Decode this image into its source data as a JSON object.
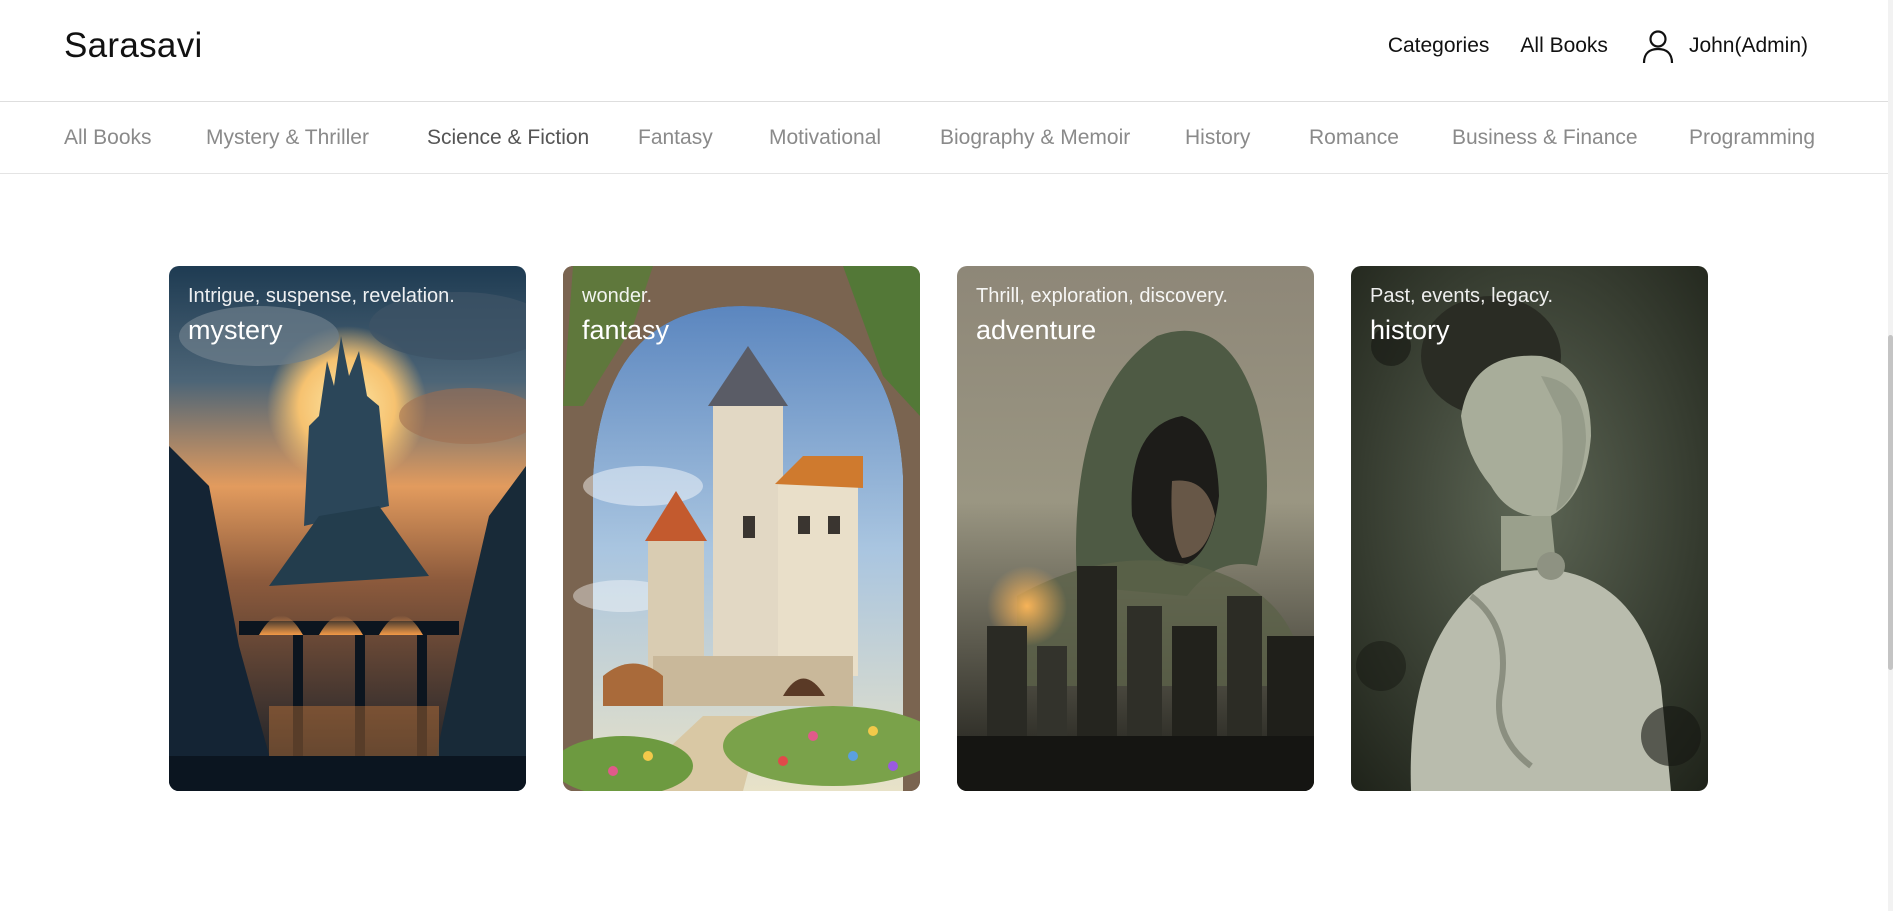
{
  "brand": "Sarasavi",
  "top_nav": {
    "categories_label": "Categories",
    "all_books_label": "All Books",
    "user_name": "John(Admin)"
  },
  "categories": [
    {
      "label": "All Books"
    },
    {
      "label": "Mystery & Thriller"
    },
    {
      "label": "Science & Fiction",
      "active": true
    },
    {
      "label": "Fantasy"
    },
    {
      "label": "Motivational"
    },
    {
      "label": "Biography & Memoir"
    },
    {
      "label": "History"
    },
    {
      "label": "Romance"
    },
    {
      "label": "Business & Finance"
    },
    {
      "label": "Programming"
    }
  ],
  "cards": [
    {
      "tagline": "Intrigue, suspense, revelation.",
      "title": "mystery",
      "image": "moonlit-castle-bridge-painting"
    },
    {
      "tagline": "wonder.",
      "title": "fantasy",
      "image": "castle-through-stone-arch-painting"
    },
    {
      "tagline": "Thrill, exploration, discovery.",
      "title": "adventure",
      "image": "hooded-figure-over-city"
    },
    {
      "tagline": "Past, events, legacy.",
      "title": "history",
      "image": "vintage-woman-portrait"
    }
  ],
  "colors": {
    "text": "#111111",
    "category_inactive": "#8a8a8a",
    "category_active": "#555555",
    "divider": "#dedede"
  }
}
